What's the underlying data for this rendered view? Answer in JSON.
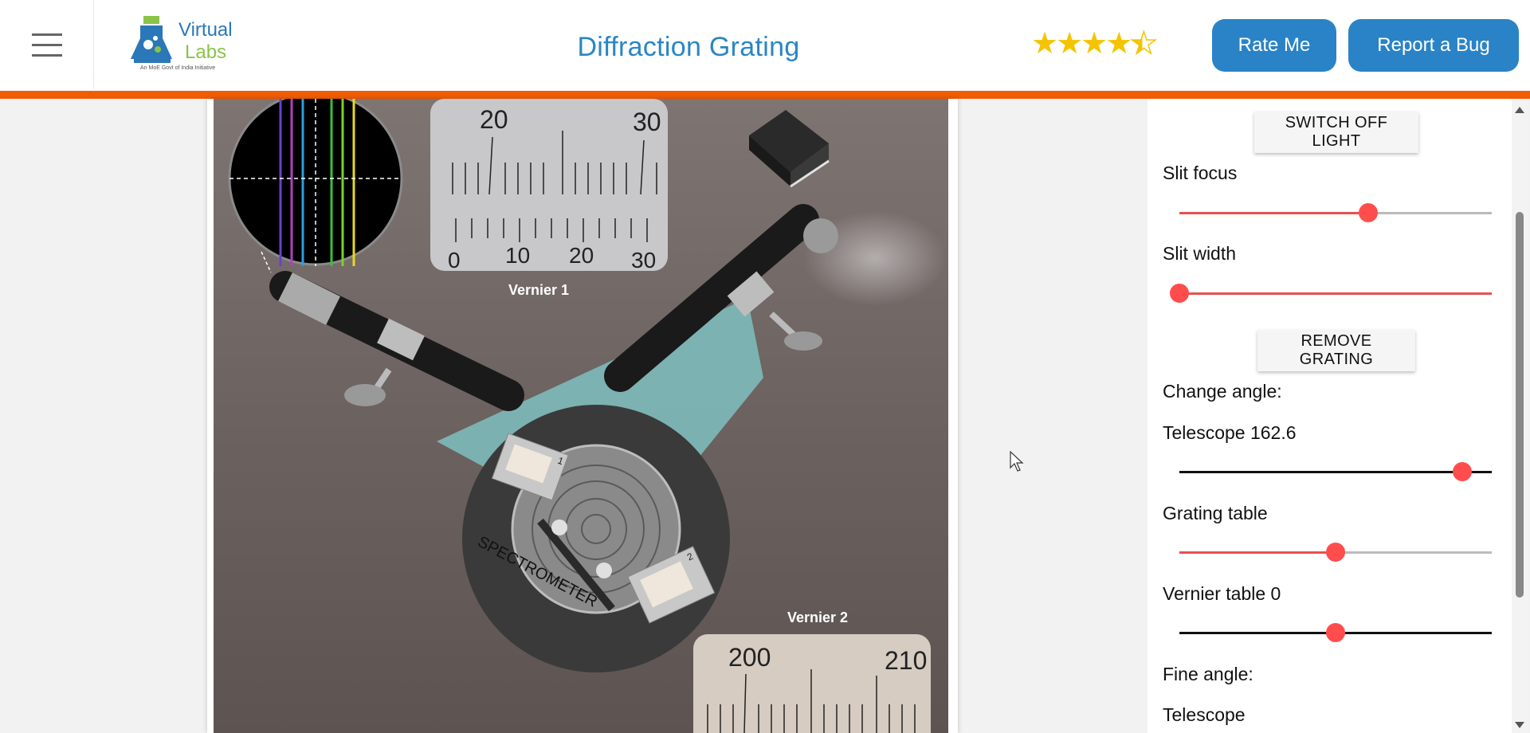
{
  "header": {
    "logo_line1": "Virtual",
    "logo_line2": "Labs",
    "logo_tagline": "An MoE Govt of India Initiative",
    "title": "Diffraction Grating",
    "rating": 4.5,
    "rate_button": "Rate Me",
    "bug_button": "Report a Bug"
  },
  "simulation": {
    "vernier1_label": "Vernier 1",
    "vernier2_label": "Vernier 2",
    "instrument_label": "SPECTROMETER",
    "vernier1_main_scale": [
      "20",
      "30"
    ],
    "vernier1_vernier_scale": [
      "0",
      "10",
      "20",
      "30"
    ],
    "vernier2_main_scale": [
      "200",
      "210"
    ],
    "spectral_line_colors": [
      "#6a3fd0",
      "#b040c0",
      "#2aa0e0",
      "#3cbd3c",
      "#7ccf2a",
      "#e8d820"
    ],
    "vernier_plate_1": "1",
    "vernier_plate_2": "2"
  },
  "controls": {
    "switch_light": "SWITCH OFF LIGHT",
    "slit_focus_label": "Slit focus",
    "slit_focus_value": 0.6,
    "slit_width_label": "Slit width",
    "slit_width_value": 0,
    "remove_grating": "REMOVE GRATING",
    "change_angle_label": "Change angle:",
    "telescope_label": "Telescope 162.6",
    "telescope_value": 0.905,
    "grating_table_label": "Grating table",
    "grating_table_value": 0.5,
    "vernier_table_label": "Vernier table 0",
    "vernier_table_value": 0.5,
    "fine_angle_label": "Fine angle:",
    "fine_telescope_label": "Telescope"
  },
  "colors": {
    "accent": "#2a83c6",
    "header_border": "#f25c05",
    "slider_thumb": "#ff4d4d",
    "slider_active": "#e85050"
  }
}
